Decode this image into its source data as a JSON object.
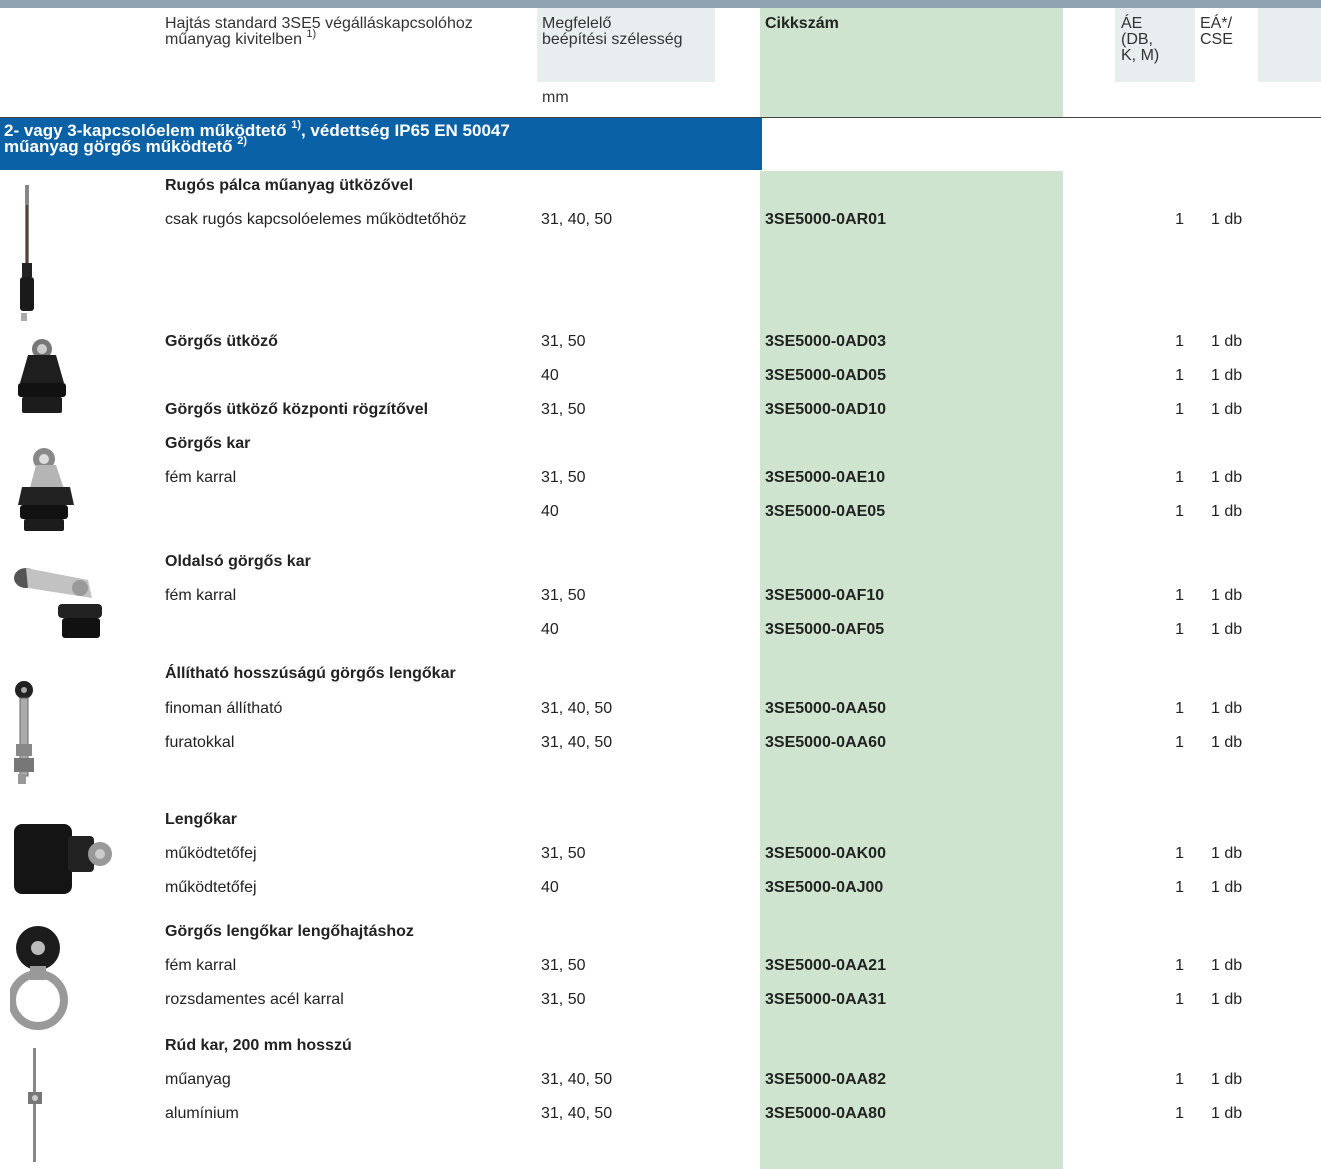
{
  "header": {
    "drive_label": "Hajtás standard 3SE5 végálláskapcsolóhoz",
    "drive_label_2": "műanyag kivitelben",
    "drive_note": "1)",
    "width_label_1": "Megfelelő",
    "width_label_2": "beépítési szélesség",
    "width_unit": "mm",
    "order_label": "Cikkszám",
    "ae_label_1": "ÁE",
    "ae_label_2": "(DB,",
    "ae_label_3": "K, M)",
    "ea_label_1": "EÁ*/",
    "ea_label_2": "CSE"
  },
  "section": {
    "title_1": "2- vagy 3-kapcsolóelem működtető ",
    "note_1": "1)",
    "title_1b": ", védettség IP65 EN 50047",
    "title_2": "műanyag görgős működtető ",
    "note_2": "2)"
  },
  "rows": [
    {
      "desc": "Rugós pálca műanyag ütközővel",
      "bold": true,
      "width": "",
      "order": "",
      "ae": "",
      "ea": ""
    },
    {
      "desc": "csak rugós kapcsolóelemes működtetőhöz",
      "bold": false,
      "width": "31, 40, 50",
      "order": "3SE5000-0AR01",
      "ae": "1",
      "ea": "1 db"
    },
    {
      "desc": "Görgős ütköző",
      "bold": true,
      "width": "31, 50",
      "order": "3SE5000-0AD03",
      "ae": "1",
      "ea": "1 db"
    },
    {
      "desc": "",
      "bold": false,
      "width": "40",
      "order": "3SE5000-0AD05",
      "ae": "1",
      "ea": "1 db"
    },
    {
      "desc": "Görgős ütköző központi rögzítővel",
      "bold": true,
      "width": "31, 50",
      "order": "3SE5000-0AD10",
      "ae": "1",
      "ea": "1 db"
    },
    {
      "desc": "Görgős kar",
      "bold": true,
      "width": "",
      "order": "",
      "ae": "",
      "ea": ""
    },
    {
      "desc": "fém karral",
      "bold": false,
      "width": "31, 50",
      "order": "3SE5000-0AE10",
      "ae": "1",
      "ea": "1 db"
    },
    {
      "desc": "",
      "bold": false,
      "width": "40",
      "order": "3SE5000-0AE05",
      "ae": "1",
      "ea": "1 db"
    },
    {
      "desc": "Oldalsó görgős kar",
      "bold": true,
      "width": "",
      "order": "",
      "ae": "",
      "ea": ""
    },
    {
      "desc": "fém karral",
      "bold": false,
      "width": "31, 50",
      "order": "3SE5000-0AF10",
      "ae": "1",
      "ea": "1 db"
    },
    {
      "desc": "",
      "bold": false,
      "width": "40",
      "order": "3SE5000-0AF05",
      "ae": "1",
      "ea": "1 db"
    },
    {
      "desc": "Állítható hosszúságú görgős lengőkar",
      "bold": true,
      "width": "",
      "order": "",
      "ae": "",
      "ea": ""
    },
    {
      "desc": "finoman állítható",
      "bold": false,
      "width": "31, 40, 50",
      "order": "3SE5000-0AA50",
      "ae": "1",
      "ea": "1 db"
    },
    {
      "desc": "furatokkal",
      "bold": false,
      "width": "31, 40, 50",
      "order": "3SE5000-0AA60",
      "ae": "1",
      "ea": "1 db"
    },
    {
      "desc": "Lengőkar",
      "bold": true,
      "width": "",
      "order": "",
      "ae": "",
      "ea": ""
    },
    {
      "desc": "működtetőfej",
      "bold": false,
      "width": "31, 50",
      "order": "3SE5000-0AK00",
      "ae": "1",
      "ea": "1 db"
    },
    {
      "desc": "működtetőfej",
      "bold": false,
      "width": "40",
      "order": "3SE5000-0AJ00",
      "ae": "1",
      "ea": "1 db"
    },
    {
      "desc": "Görgős lengőkar lengőhajtáshoz",
      "bold": true,
      "width": "",
      "order": "",
      "ae": "",
      "ea": ""
    },
    {
      "desc": "fém karral",
      "bold": false,
      "width": "31, 50",
      "order": "3SE5000-0AA21",
      "ae": "1",
      "ea": "1 db"
    },
    {
      "desc": "rozsdamentes acél karral",
      "bold": false,
      "width": "31, 50",
      "order": "3SE5000-0AA31",
      "ae": "1",
      "ea": "1 db"
    },
    {
      "desc": "Rúd kar, 200 mm hosszú",
      "bold": true,
      "width": "",
      "order": "",
      "ae": "",
      "ea": ""
    },
    {
      "desc": "műanyag",
      "bold": false,
      "width": "31, 40, 50",
      "order": "3SE5000-0AA82",
      "ae": "1",
      "ea": "1 db"
    },
    {
      "desc": "alumínium",
      "bold": false,
      "width": "31, 40, 50",
      "order": "3SE5000-0AA80",
      "ae": "1",
      "ea": "1 db"
    }
  ],
  "pictures": [
    "spring-rod-actuator-icon",
    "roller-plunger-icon",
    "roller-lever-icon",
    "side-roller-lever-icon",
    "adjustable-roller-lever-icon",
    "rotary-lever-head-icon",
    "roller-swing-lever-icon",
    "rod-lever-icon"
  ],
  "colors": {
    "section_bg": "#0a61a6",
    "order_column_bg": "#cfe4cf",
    "header_bg": "#e8edf0",
    "top_bar": "#8fa3b2"
  }
}
